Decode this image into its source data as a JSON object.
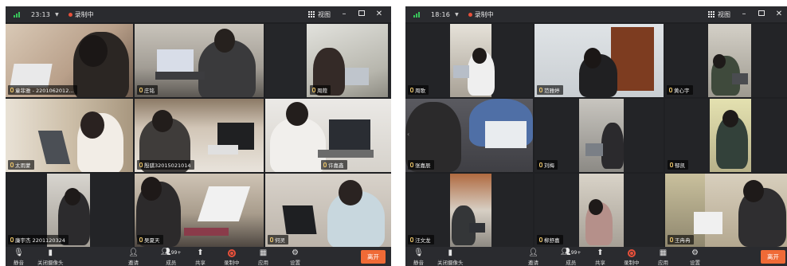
{
  "colors": {
    "accent_green": "#38c45a",
    "record_red": "#e8503a",
    "leave_orange": "#f06a36",
    "bg_dark": "#1f2023"
  },
  "left": {
    "time": "23:13",
    "recording": "录制中",
    "view_label": "视图",
    "participants": [
      {
        "name": "童菲雅 - 2201062012..."
      },
      {
        "name": "庄铭"
      },
      {
        "name": "周葭"
      },
      {
        "name": "太雨蒙"
      },
      {
        "name": "殷骐32015021014"
      },
      {
        "name": "许嘉鑫"
      },
      {
        "name": "廉宇杰 2201120324"
      },
      {
        "name": "吴夏天"
      },
      {
        "name": "何灵"
      }
    ],
    "toolbar": {
      "mute": "静音",
      "camera": "关闭摄像头",
      "invite": "邀请",
      "members": "成员",
      "members_count": "99+",
      "share": "共享",
      "recording": "录制中",
      "apps": "应用",
      "settings": "设置",
      "leave": "离开"
    }
  },
  "right": {
    "time": "18:16",
    "recording": "录制中",
    "view_label": "视图",
    "participants": [
      {
        "name": "周歌"
      },
      {
        "name": "范雅婷"
      },
      {
        "name": "黄心宇"
      },
      {
        "name": "张嘉辰"
      },
      {
        "name": "刘梅"
      },
      {
        "name": "郁凯"
      },
      {
        "name": "汪文龙"
      },
      {
        "name": "柳舒嘉"
      },
      {
        "name": "王冉冉"
      }
    ],
    "toolbar": {
      "mute": "静音",
      "camera": "关闭摄像头",
      "invite": "邀请",
      "members": "成员",
      "members_count": "99+",
      "share": "共享",
      "recording": "录制中",
      "apps": "应用",
      "settings": "设置",
      "leave": "离开"
    }
  }
}
